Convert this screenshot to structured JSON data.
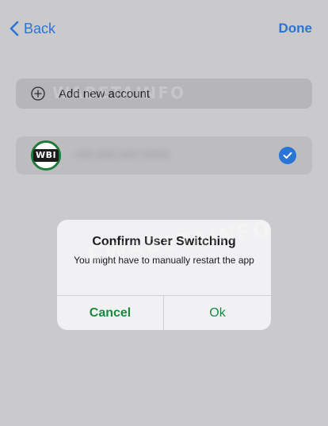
{
  "nav": {
    "back_label": "Back",
    "done_label": "Done"
  },
  "add_account": {
    "label": "Add new account",
    "icon": "plus-circle-icon"
  },
  "account": {
    "avatar_text": "WBI",
    "phone": "+00 000 000 0000",
    "selected": true,
    "check_icon": "checkmark-circle-icon"
  },
  "watermark": {
    "text": "WABETAINFO",
    "text2": "CWABETAINFO"
  },
  "alert": {
    "title": "Confirm User Switching",
    "message": "You might have to manually restart the app",
    "cancel_label": "Cancel",
    "ok_label": "Ok"
  },
  "colors": {
    "background": "#cacacd",
    "ios_blue": "#2a74d6",
    "whatsapp_green": "#178a3f",
    "alert_background": "#f1f1f3"
  }
}
